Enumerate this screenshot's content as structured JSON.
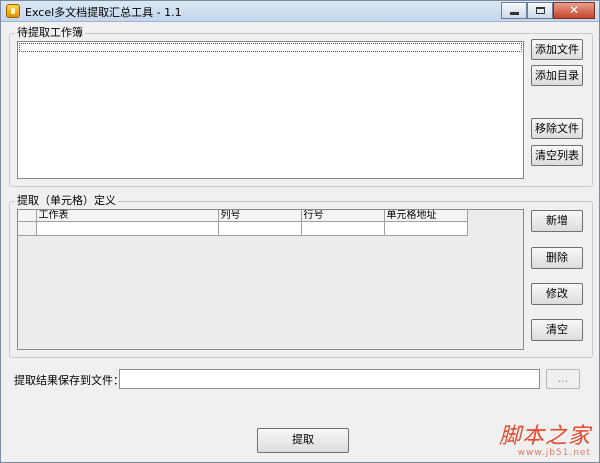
{
  "window": {
    "title": "Excel多文档提取汇总工具 - 1.1"
  },
  "workbooks_group": {
    "label": "待提取工作簿",
    "buttons": {
      "add_file": "添加文件",
      "add_folder": "添加目录",
      "remove_file": "移除文件",
      "clear_list": "清空列表"
    }
  },
  "extract_group": {
    "label": "提取（单元格）定义",
    "columns": [
      "",
      "工作表",
      "列号",
      "行号",
      "单元格地址"
    ],
    "buttons": {
      "add": "新增",
      "delete": "删除",
      "edit": "修改",
      "clear": "清空"
    }
  },
  "save": {
    "label": "提取结果保存到文件：",
    "value": "",
    "browse": "..."
  },
  "extract_button": "提取",
  "watermark": {
    "text": "脚本之家",
    "url": "www.jb51.net"
  }
}
